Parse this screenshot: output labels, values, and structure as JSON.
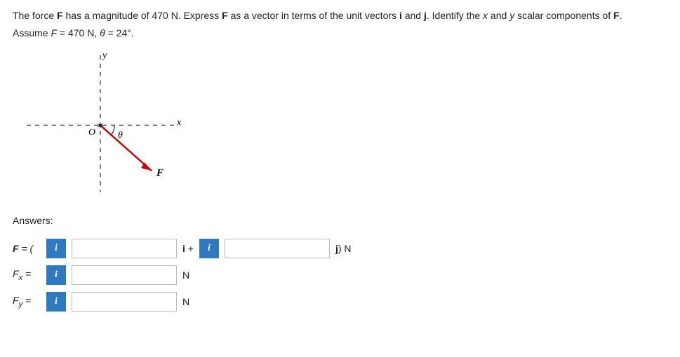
{
  "problem": {
    "prefix": "The force ",
    "F1": "F",
    "mid1": " has a magnitude of 470 N. Express ",
    "F2": "F",
    "mid2": " as a vector in terms of the unit vectors ",
    "ivec": "i",
    "and": " and ",
    "jvec": "j",
    "mid3": ". Identify the ",
    "xvar": "x",
    "and2": " and ",
    "yvar": "y",
    "suffix": " scalar components of ",
    "F3": "F",
    "end": "."
  },
  "assume": {
    "prefix": "Assume ",
    "Fvar": "F",
    "eq": " = 470 N, ",
    "theta": "θ",
    "val": " = 24°."
  },
  "diagram": {
    "x_label": "x",
    "y_label": "y",
    "O_label": "O",
    "theta_label": "θ",
    "F_label": "F"
  },
  "answers": {
    "label": "Answers:",
    "rowF": {
      "prefix": "F = (",
      "info": "i",
      "mid": "i +",
      "info2": "i",
      "suffix": "j) N"
    },
    "rowFx": {
      "label_var": "F",
      "label_sub": "x",
      "label_eq": " =",
      "info": "i",
      "unit": "N"
    },
    "rowFy": {
      "label_var": "F",
      "label_sub": "y",
      "label_eq": " =",
      "info": "i",
      "unit": "N"
    },
    "inputs": {
      "Fi": "",
      "Fj": "",
      "Fx": "",
      "Fy": ""
    }
  }
}
